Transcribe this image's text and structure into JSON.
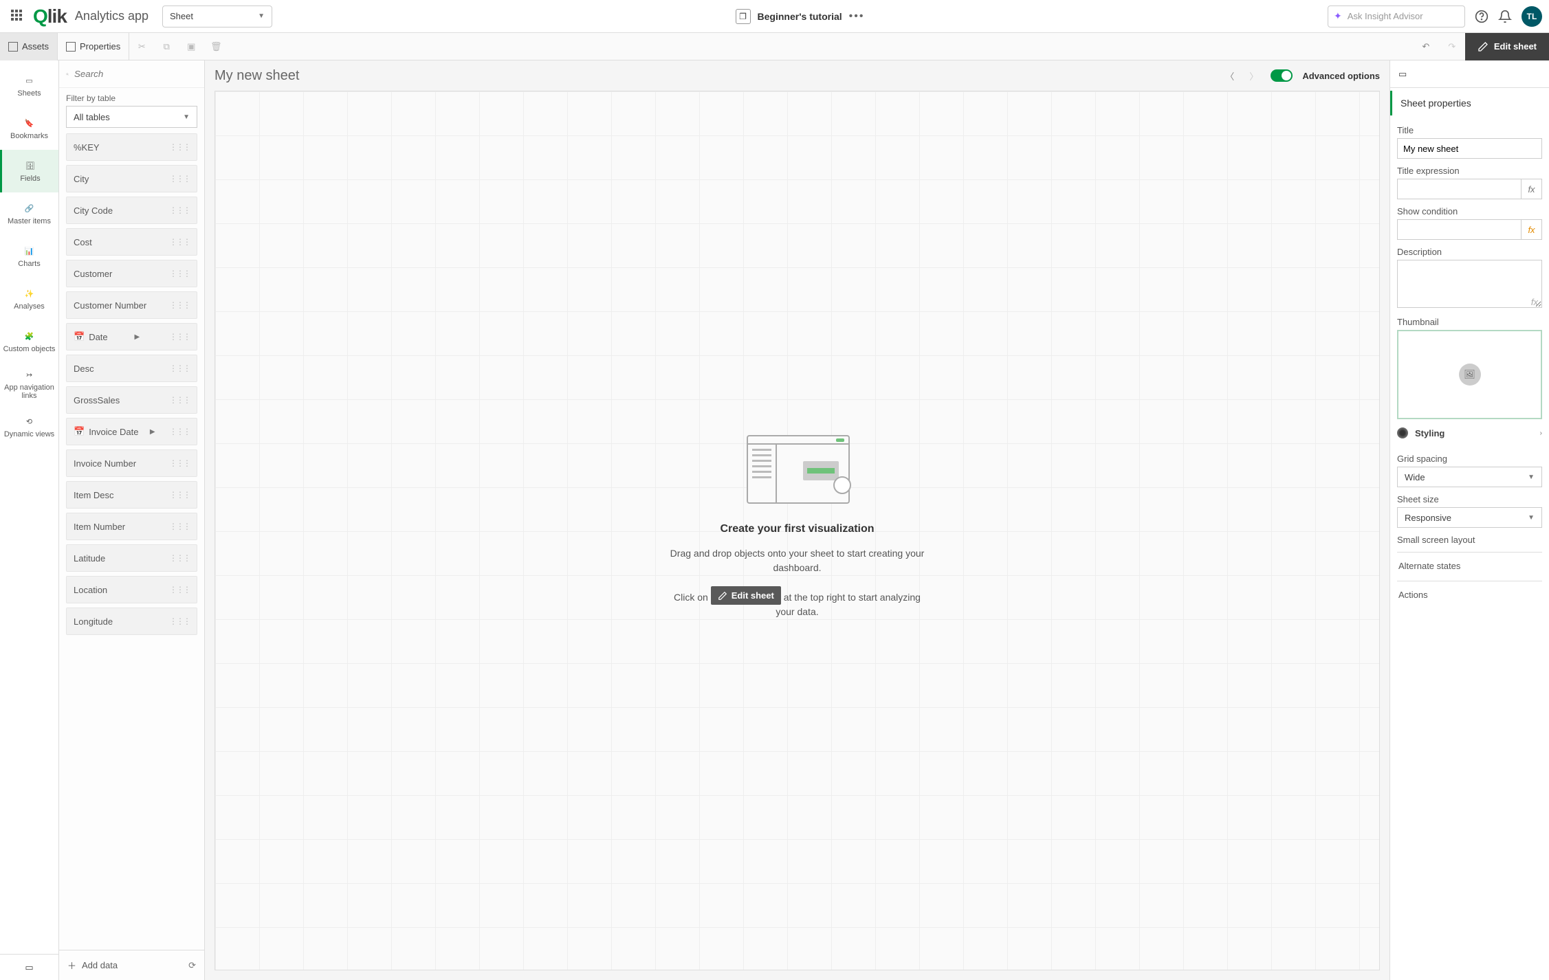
{
  "topbar": {
    "logo": "Qlik",
    "appName": "Analytics app",
    "sheetDropdown": "Sheet",
    "tutorialName": "Beginner's tutorial",
    "insightPlaceholder": "Ask Insight Advisor",
    "avatar": "TL"
  },
  "toolbar": {
    "assets": "Assets",
    "properties": "Properties",
    "editSheet": "Edit sheet"
  },
  "rail": {
    "items": [
      {
        "label": "Sheets"
      },
      {
        "label": "Bookmarks"
      },
      {
        "label": "Fields"
      },
      {
        "label": "Master items"
      },
      {
        "label": "Charts"
      },
      {
        "label": "Analyses"
      },
      {
        "label": "Custom objects"
      },
      {
        "label": "App navigation links"
      },
      {
        "label": "Dynamic views"
      }
    ]
  },
  "fieldsPanel": {
    "searchPlaceholder": "Search",
    "filterLabel": "Filter by table",
    "tableDropdown": "All tables",
    "fields": [
      {
        "name": "%KEY"
      },
      {
        "name": "City"
      },
      {
        "name": "City Code"
      },
      {
        "name": "Cost"
      },
      {
        "name": "Customer"
      },
      {
        "name": "Customer Number"
      },
      {
        "name": "Date",
        "date": true
      },
      {
        "name": "Desc"
      },
      {
        "name": "GrossSales"
      },
      {
        "name": "Invoice Date",
        "date": true
      },
      {
        "name": "Invoice Number"
      },
      {
        "name": "Item Desc"
      },
      {
        "name": "Item Number"
      },
      {
        "name": "Latitude"
      },
      {
        "name": "Location"
      },
      {
        "name": "Longitude"
      }
    ],
    "addData": "Add data"
  },
  "canvas": {
    "sheetTitle": "My new sheet",
    "advancedOptions": "Advanced options",
    "empty": {
      "title": "Create your first visualization",
      "line1": "Drag and drop objects onto your sheet to start creating your dashboard.",
      "prefix": "Click on",
      "btn": "Edit sheet",
      "suffix": "at the top right to start analyzing your data."
    }
  },
  "props": {
    "header": "Sheet properties",
    "titleLabel": "Title",
    "titleValue": "My new sheet",
    "titleExprLabel": "Title expression",
    "showCondLabel": "Show condition",
    "descLabel": "Description",
    "thumbLabel": "Thumbnail",
    "styling": "Styling",
    "gridSpacingLabel": "Grid spacing",
    "gridSpacingValue": "Wide",
    "sheetSizeLabel": "Sheet size",
    "sheetSizeValue": "Responsive",
    "smallScreenLabel": "Small screen layout",
    "altStates": "Alternate states",
    "actions": "Actions"
  }
}
